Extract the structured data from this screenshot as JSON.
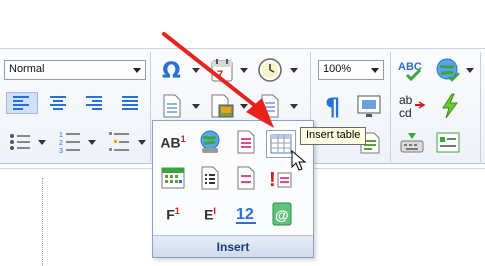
{
  "ribbon": {
    "style_select": {
      "value": "Normal"
    },
    "zoom_select": {
      "value": "100%"
    },
    "text_icons": {
      "ab_super": "AB",
      "ab_super_num": "1",
      "footnote": "F",
      "footnote_num": "1",
      "endnote": "E",
      "endnote_num": "I",
      "numbering_12": "12",
      "abcd_top": "ab",
      "abcd_bottom": "cd"
    }
  },
  "popup": {
    "footer_label": "Insert",
    "tooltip": "Insert table"
  },
  "colors": {
    "accent_blue": "#2a6fd6",
    "annotation_arrow": "#e8231b",
    "popup_footer_text": "#1a3a84"
  }
}
